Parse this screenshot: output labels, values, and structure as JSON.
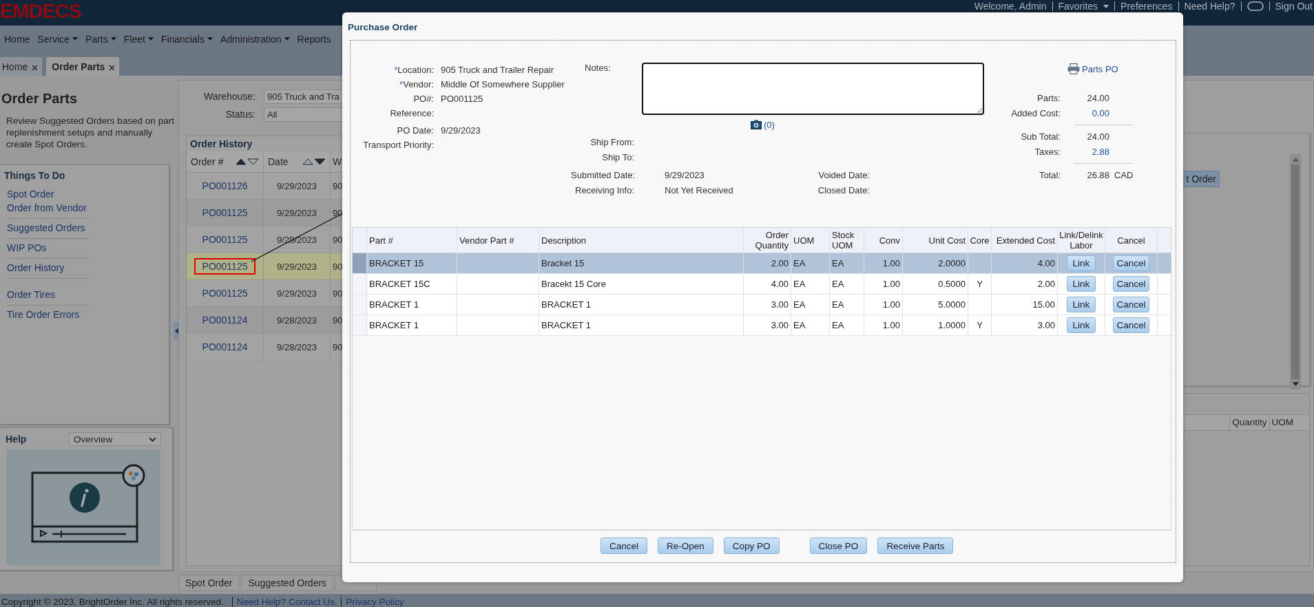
{
  "header": {
    "logo": "EMDECS",
    "links": [
      {
        "kind": "link",
        "label": "Welcome, Admin",
        "has_menu": false
      },
      {
        "kind": "link",
        "label": "Favorites",
        "has_menu": true
      },
      {
        "kind": "link",
        "label": "Preferences",
        "has_menu": false
      },
      {
        "kind": "link",
        "label": "Need Help?",
        "has_menu": false
      },
      {
        "kind": "chat"
      },
      {
        "kind": "link",
        "label": "Sign Out",
        "has_menu": false
      }
    ]
  },
  "nav": [
    {
      "label": "Home",
      "has_menu": false
    },
    {
      "label": "Service",
      "has_menu": true
    },
    {
      "label": "Parts",
      "has_menu": true
    },
    {
      "label": "Fleet",
      "has_menu": true
    },
    {
      "label": "Financials",
      "has_menu": true
    },
    {
      "label": "Administration",
      "has_menu": true
    },
    {
      "label": "Reports",
      "has_menu": false
    }
  ],
  "tabs": [
    {
      "label": "Home",
      "selected": false
    },
    {
      "label": "Order Parts",
      "selected": true
    }
  ],
  "sidebar": {
    "title": "Order Parts",
    "description": "Review Suggested Orders based on part replenishment setups and manually create Spot Orders.",
    "todo_title": "Things To Do",
    "sections": [
      [
        [
          "Spot Order",
          "Order from Vendor"
        ],
        [
          "Suggested Orders"
        ],
        [
          "WIP POs"
        ],
        [
          "Order History"
        ]
      ],
      [
        [
          "Order Tires"
        ],
        [
          "Tire Order Errors"
        ]
      ]
    ],
    "help": {
      "title": "Help",
      "select": "Overview"
    }
  },
  "filters": [
    {
      "label": "Warehouse:",
      "value": "905 Truck and Tra"
    },
    {
      "label": "Status:",
      "value": "All"
    }
  ],
  "order_history": {
    "title": "Order History",
    "columns": [
      {
        "label": "Order #",
        "sort_ascending": true,
        "sort_descending": false
      },
      {
        "label": "Date",
        "sort_ascending": false,
        "sort_descending": true
      },
      {
        "label": "W"
      }
    ],
    "rows": [
      {
        "order": "PO001126",
        "date": "9/29/2023",
        "column_3": "90",
        "selected": false,
        "highlighted": false
      },
      {
        "order": "PO001125",
        "date": "9/29/2023",
        "column_3": "90",
        "selected": false,
        "highlighted": false
      },
      {
        "order": "PO001125",
        "date": "9/29/2023",
        "column_3": "90",
        "selected": false,
        "highlighted": false
      },
      {
        "order": "PO001125",
        "date": "9/29/2023",
        "column_3": "90",
        "selected": true,
        "highlighted": true
      },
      {
        "order": "PO001125",
        "date": "9/29/2023",
        "column_3": "90",
        "selected": false,
        "highlighted": false
      },
      {
        "order": "PO001124",
        "date": "9/28/2023",
        "column_3": "90",
        "selected": false,
        "highlighted": false
      },
      {
        "order": "PO001124",
        "date": "9/28/2023",
        "column_3": "90",
        "selected": false,
        "highlighted": false
      }
    ]
  },
  "bottom_tabs": [
    "Spot Order",
    "Suggested Orders"
  ],
  "right_panel": {
    "button": "t Order",
    "columns": [
      "Quantity",
      "UOM"
    ]
  },
  "footer": {
    "copyright": "Copyright © 2023, BrightOrder Inc. All rights reserved.",
    "links": [
      "Need Help? Contact Us.",
      "Privacy Policy"
    ]
  },
  "modal": {
    "title": "Purchase Order",
    "fields": [
      {
        "mark": "*",
        "label": "Location:",
        "value": "905 Truck and Trailer Repair"
      },
      {
        "mark": "*",
        "label": "Vendor:",
        "value": "Middle Of Somewhere Supplier"
      },
      {
        "label": "PO#:",
        "value": "PO001125"
      },
      {
        "label": "Reference:"
      },
      {
        "label": "PO Date:",
        "value": "9/29/2023"
      },
      {
        "label": "Transport Priority:"
      }
    ],
    "notes_label": "Notes:",
    "attachments": "(0)",
    "ship": [
      {
        "label": "Ship From:"
      },
      {
        "label": "Ship To:"
      }
    ],
    "dates": [
      {
        "label": "Submitted Date:",
        "value": "9/29/2023",
        "right_label": "Voided Date:"
      },
      {
        "label": "Receiving Info:",
        "value": "Not Yet Received",
        "right_label": "Closed Date:"
      }
    ],
    "print_link": "Parts PO",
    "totals": [
      [
        {
          "label": "Parts:",
          "value": "24.00",
          "link": false
        },
        {
          "label": "Added Cost:",
          "value": "0.00",
          "link": true
        }
      ],
      [
        {
          "label": "Sub Total:",
          "value": "24.00",
          "link": false
        },
        {
          "label": "Taxes:",
          "value": "2.88",
          "link": true
        }
      ],
      [
        {
          "label": "Total:",
          "value": "26.88",
          "link": false,
          "currency": "CAD"
        }
      ]
    ],
    "table": {
      "columns": [
        "Part #",
        "Vendor Part #",
        "Description",
        "Order Quantity",
        "UOM",
        "Stock UOM",
        "Conv",
        "Unit Cost",
        "Core",
        "Extended Cost",
        "Link/Delink Labor",
        "Cancel"
      ],
      "rows": [
        {
          "selected": true,
          "part": "BRACKET 15",
          "description": "Bracket 15",
          "qty": "2.00",
          "uom": "EA",
          "stock_uom": "EA",
          "conv": "1.00",
          "unit_cost": "2.0000",
          "extended": "4.00",
          "link": "Link",
          "cancel": "Cancel"
        },
        {
          "selected": false,
          "part": "BRACKET 15C",
          "description": "Bracekt 15 Core",
          "qty": "4.00",
          "uom": "EA",
          "stock_uom": "EA",
          "conv": "1.00",
          "unit_cost": "0.5000",
          "core": "Y",
          "extended": "2.00",
          "link": "Link",
          "cancel": "Cancel"
        },
        {
          "selected": false,
          "part": "BRACKET 1",
          "description": "BRACKET 1",
          "qty": "3.00",
          "uom": "EA",
          "stock_uom": "EA",
          "conv": "1.00",
          "unit_cost": "5.0000",
          "extended": "15.00",
          "link": "Link",
          "cancel": "Cancel"
        },
        {
          "selected": false,
          "part": "BRACKET 1",
          "description": "BRACKET 1",
          "qty": "3.00",
          "uom": "EA",
          "stock_uom": "EA",
          "conv": "1.00",
          "unit_cost": "1.0000",
          "core": "Y",
          "extended": "3.00",
          "link": "Link",
          "cancel": "Cancel"
        }
      ]
    },
    "button_groups": [
      [
        "Cancel",
        "Re-Open",
        "Copy PO"
      ],
      [
        "Close PO",
        "Receive Parts"
      ]
    ]
  }
}
